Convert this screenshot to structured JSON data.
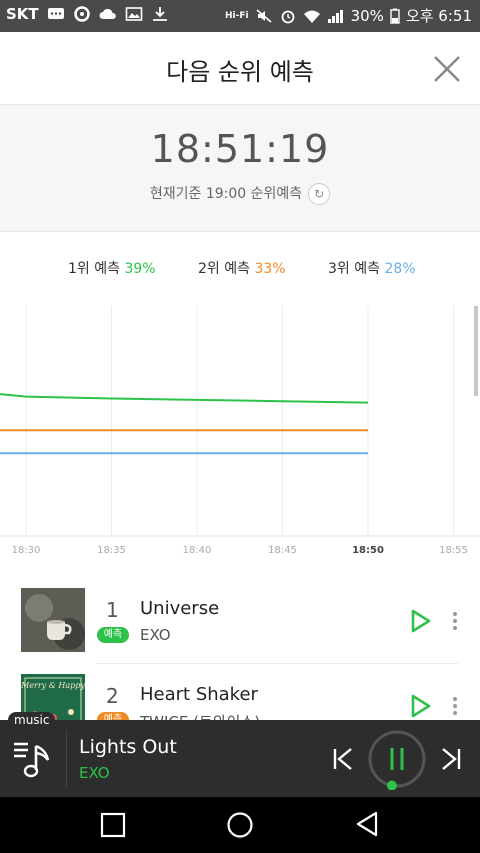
{
  "status_bar": {
    "carrier": "SKT",
    "wifi_label": "Hi-Fi",
    "battery": "30%",
    "time": "오후 6:51"
  },
  "header": {
    "title": "다음 순위 예측"
  },
  "countdown": {
    "time": "18:51:19",
    "subtitle": "현재기준 19:00 순위예측"
  },
  "legend": [
    {
      "label": "1위 예측",
      "value": "39%",
      "color": "#2ec24a"
    },
    {
      "label": "2위 예측",
      "value": "33%",
      "color": "#f08a24"
    },
    {
      "label": "3위 예측",
      "value": "28%",
      "color": "#6aaee8"
    }
  ],
  "chart_data": {
    "type": "line",
    "x_ticks": [
      "18:30",
      "18:35",
      "18:40",
      "18:45",
      "18:50",
      "18:55"
    ],
    "current_tick": "18:50",
    "series": [
      {
        "name": "1위 예측",
        "color": "#2ec24a",
        "x": [
          "18:28",
          "18:30",
          "18:35",
          "18:40",
          "18:45",
          "18:50"
        ],
        "y": [
          41.0,
          40.3,
          39.9,
          39.6,
          39.3,
          39.0
        ]
      },
      {
        "name": "2위 예측",
        "color": "#f08a24",
        "x": [
          "18:28",
          "18:50"
        ],
        "y": [
          33.0,
          33.0
        ]
      },
      {
        "name": "3위 예측",
        "color": "#6aaee8",
        "x": [
          "18:28",
          "18:50"
        ],
        "y": [
          28.0,
          28.0
        ]
      }
    ],
    "grid": true
  },
  "songs": [
    {
      "rank": "1",
      "title": "Universe",
      "badge": "예측",
      "badge_color": "#2ec24a",
      "artist": "EXO"
    },
    {
      "rank": "2",
      "title": "Heart Shaker",
      "badge": "예측",
      "badge_color": "#f08a24",
      "artist": "TWICE (트와이스)"
    }
  ],
  "album_art_text": "Merry & Happy",
  "player": {
    "tag": "music",
    "title": "Lights Out",
    "artist": "EXO",
    "progress": 0.03
  }
}
